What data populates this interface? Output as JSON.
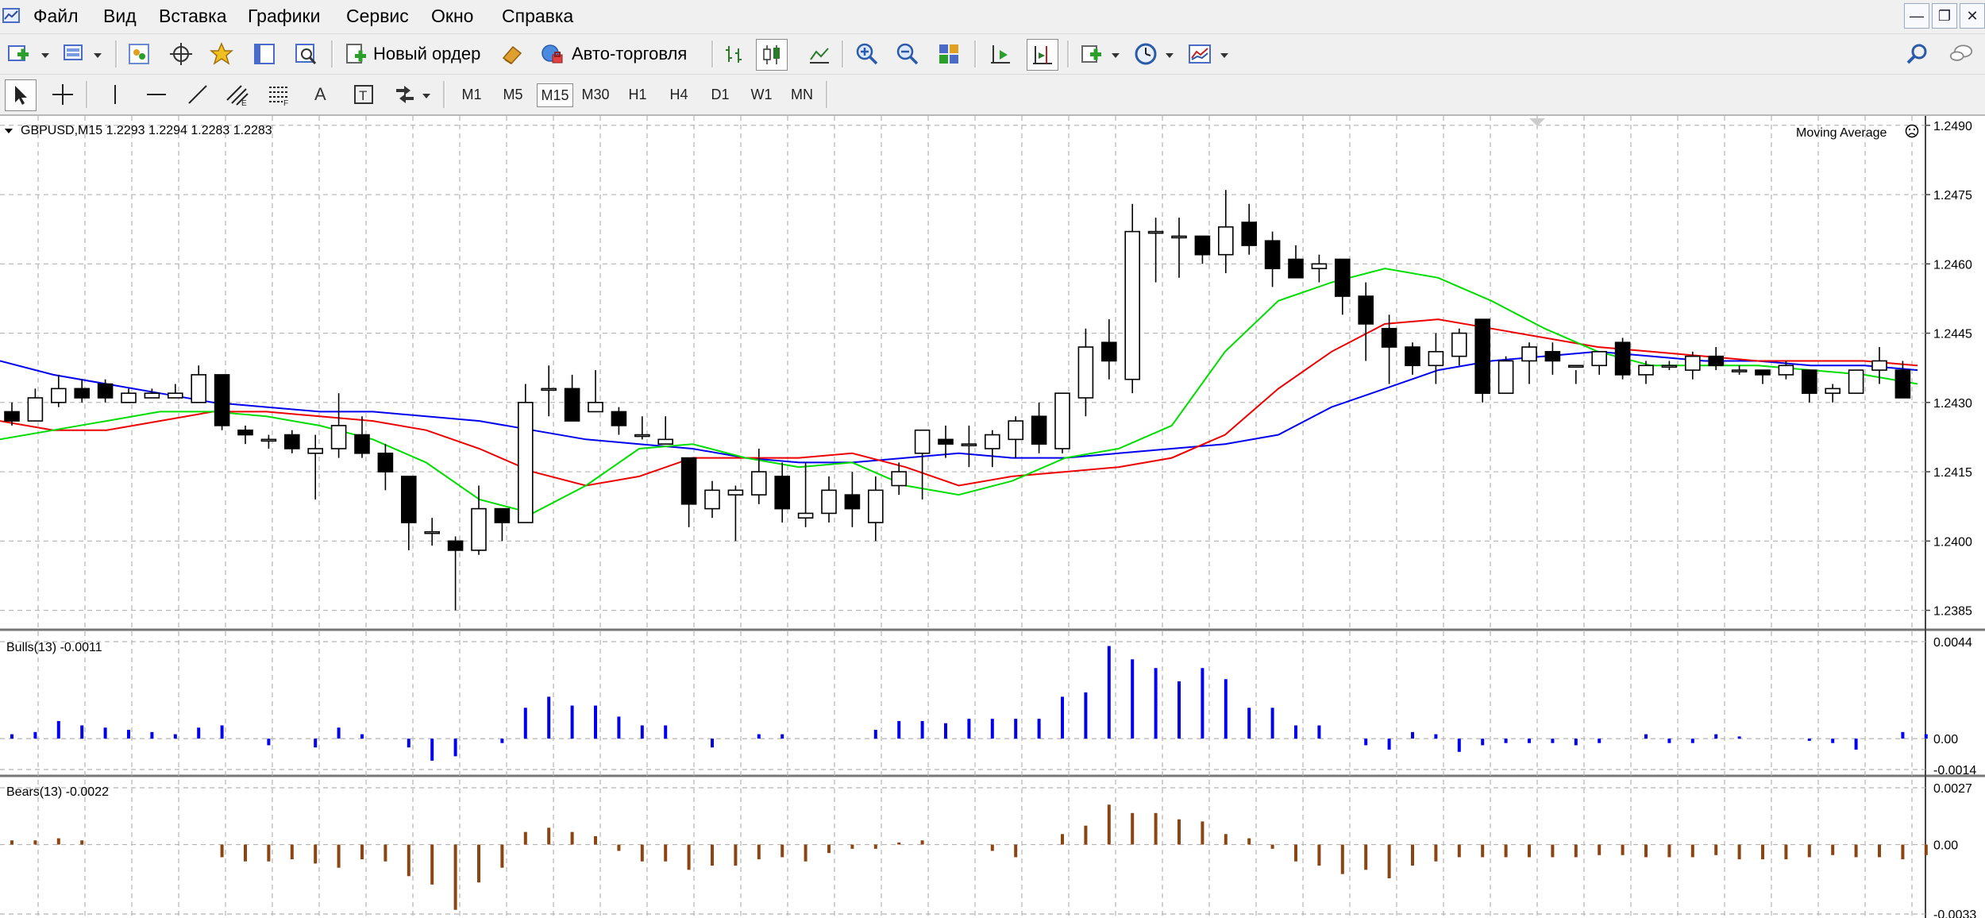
{
  "menu": {
    "items": [
      "Файл",
      "Вид",
      "Вставка",
      "Графики",
      "Сервис",
      "Окно",
      "Справка"
    ],
    "window_buttons": [
      "minimize-button",
      "restore-button",
      "close-button"
    ]
  },
  "toolbar": {
    "new_order_label": "Новый ордер",
    "auto_trading_label": "Авто-торговля",
    "timeframes": [
      "M1",
      "M5",
      "M15",
      "M30",
      "H1",
      "H4",
      "D1",
      "W1",
      "MN"
    ],
    "active_timeframe": "M15",
    "text_tool_label": "A"
  },
  "chart": {
    "header": "GBPUSD,M15  1.2293 1.2294 1.2283 1.2283",
    "symbol": "GBPUSD",
    "timeframe": "M15",
    "ohlc": [
      1.2293,
      1.2294,
      1.2283,
      1.2283
    ],
    "indicator_label": "Moving Average",
    "price_ticks": [
      "1.2490",
      "1.2475",
      "1.2460",
      "1.2445",
      "1.2430",
      "1.2415",
      "1.2400",
      "1.2385"
    ],
    "bulls_label": "Bulls(13) -0.0011",
    "bulls_ticks": [
      "0.0044",
      "0.00",
      "-0.0014"
    ],
    "bears_label": "Bears(13) -0.0022",
    "bears_ticks": [
      "0.0027",
      "0.00",
      "-0.0033"
    ],
    "colors": {
      "bulls": "#0000ee",
      "bears": "#8b4513",
      "ma_fast": "#00dd00",
      "ma_mid": "#ee0000",
      "ma_slow": "#0000ee",
      "grid": "#b4b4b4"
    }
  },
  "chart_data": [
    {
      "type": "candlestick",
      "title": "GBPUSD,M15",
      "ylim": [
        1.2382,
        1.2491
      ],
      "candles": [
        [
          1.2428,
          1.243,
          1.2425,
          1.2426
        ],
        [
          1.2426,
          1.2433,
          1.2426,
          1.2431
        ],
        [
          1.243,
          1.2436,
          1.2429,
          1.2433
        ],
        [
          1.2433,
          1.2435,
          1.243,
          1.2431
        ],
        [
          1.2434,
          1.2435,
          1.243,
          1.2431
        ],
        [
          1.243,
          1.2433,
          1.243,
          1.2432
        ],
        [
          1.2431,
          1.2433,
          1.2431,
          1.2432
        ],
        [
          1.2431,
          1.2434,
          1.2431,
          1.2432
        ],
        [
          1.243,
          1.2438,
          1.243,
          1.2436
        ],
        [
          1.2436,
          1.2436,
          1.2424,
          1.2425
        ],
        [
          1.2424,
          1.2425,
          1.2421,
          1.2423
        ],
        [
          1.2422,
          1.2423,
          1.242,
          1.2422
        ],
        [
          1.2423,
          1.2424,
          1.2419,
          1.242
        ],
        [
          1.2419,
          1.2423,
          1.2409,
          1.242
        ],
        [
          1.242,
          1.2432,
          1.2418,
          1.2425
        ],
        [
          1.2423,
          1.2427,
          1.2418,
          1.2419
        ],
        [
          1.2419,
          1.2421,
          1.2411,
          1.2415
        ],
        [
          1.2414,
          1.2414,
          1.2398,
          1.2404
        ],
        [
          1.2402,
          1.2405,
          1.2399,
          1.2402
        ],
        [
          1.24,
          1.2401,
          1.2385,
          1.2398
        ],
        [
          1.2398,
          1.2412,
          1.2397,
          1.2407
        ],
        [
          1.2407,
          1.2407,
          1.24,
          1.2404
        ],
        [
          1.2404,
          1.2434,
          1.2404,
          1.243
        ],
        [
          1.2433,
          1.2438,
          1.2427,
          1.2433
        ],
        [
          1.2433,
          1.2436,
          1.2426,
          1.2426
        ],
        [
          1.2428,
          1.2437,
          1.2428,
          1.243
        ],
        [
          1.2428,
          1.2429,
          1.2423,
          1.2425
        ],
        [
          1.2423,
          1.2427,
          1.2422,
          1.2423
        ],
        [
          1.2421,
          1.2427,
          1.2421,
          1.2422
        ],
        [
          1.2418,
          1.2418,
          1.2403,
          1.2408
        ],
        [
          1.2407,
          1.2413,
          1.2405,
          1.2411
        ],
        [
          1.241,
          1.2412,
          1.24,
          1.2411
        ],
        [
          1.241,
          1.242,
          1.2408,
          1.2415
        ],
        [
          1.2414,
          1.2417,
          1.2404,
          1.2407
        ],
        [
          1.2405,
          1.2417,
          1.2403,
          1.2406
        ],
        [
          1.2406,
          1.2414,
          1.2404,
          1.2411
        ],
        [
          1.241,
          1.2415,
          1.2403,
          1.2407
        ],
        [
          1.2404,
          1.2414,
          1.24,
          1.2411
        ],
        [
          1.2412,
          1.2417,
          1.241,
          1.2415
        ],
        [
          1.2419,
          1.2423,
          1.2409,
          1.2424
        ],
        [
          1.2422,
          1.2425,
          1.2418,
          1.2421
        ],
        [
          1.2421,
          1.2425,
          1.2416,
          1.2421
        ],
        [
          1.242,
          1.2424,
          1.2416,
          1.2423
        ],
        [
          1.2422,
          1.2427,
          1.2418,
          1.2426
        ],
        [
          1.2427,
          1.243,
          1.2419,
          1.2421
        ],
        [
          1.242,
          1.2431,
          1.2419,
          1.2432
        ],
        [
          1.2431,
          1.2446,
          1.2427,
          1.2442
        ],
        [
          1.2443,
          1.2448,
          1.2435,
          1.2439
        ],
        [
          1.2435,
          1.2473,
          1.2432,
          1.2467
        ],
        [
          1.2467,
          1.247,
          1.2456,
          1.2467
        ],
        [
          1.2466,
          1.247,
          1.2457,
          1.2466
        ],
        [
          1.2466,
          1.2466,
          1.246,
          1.2462
        ],
        [
          1.2462,
          1.2476,
          1.2458,
          1.2468
        ],
        [
          1.2469,
          1.2473,
          1.2462,
          1.2464
        ],
        [
          1.2465,
          1.2467,
          1.2455,
          1.2459
        ],
        [
          1.2461,
          1.2464,
          1.2457,
          1.2457
        ],
        [
          1.2459,
          1.2462,
          1.2456,
          1.246
        ],
        [
          1.2461,
          1.246,
          1.2449,
          1.2453
        ],
        [
          1.2453,
          1.2456,
          1.2439,
          1.2447
        ],
        [
          1.2446,
          1.2449,
          1.2434,
          1.2442
        ],
        [
          1.2442,
          1.2443,
          1.2436,
          1.2438
        ],
        [
          1.2438,
          1.2445,
          1.2434,
          1.2441
        ],
        [
          1.244,
          1.2446,
          1.2438,
          1.2445
        ],
        [
          1.2448,
          1.2448,
          1.243,
          1.2432
        ],
        [
          1.2432,
          1.244,
          1.2432,
          1.2439
        ],
        [
          1.2439,
          1.2443,
          1.2434,
          1.2442
        ],
        [
          1.2441,
          1.2443,
          1.2436,
          1.2439
        ],
        [
          1.2438,
          1.2437,
          1.2434,
          1.2438
        ],
        [
          1.2438,
          1.2441,
          1.2436,
          1.2441
        ],
        [
          1.2443,
          1.2444,
          1.2435,
          1.2436
        ],
        [
          1.2436,
          1.2439,
          1.2434,
          1.2438
        ],
        [
          1.2438,
          1.2439,
          1.2437,
          1.2438
        ],
        [
          1.2437,
          1.2441,
          1.2435,
          1.244
        ],
        [
          1.244,
          1.2442,
          1.2437,
          1.2438
        ],
        [
          1.2437,
          1.2438,
          1.2436,
          1.2437
        ],
        [
          1.2437,
          1.2437,
          1.2434,
          1.2436
        ],
        [
          1.2436,
          1.2439,
          1.2435,
          1.2438
        ],
        [
          1.2437,
          1.2436,
          1.243,
          1.2432
        ],
        [
          1.2432,
          1.2434,
          1.243,
          1.2433
        ],
        [
          1.2432,
          1.2437,
          1.2432,
          1.2437
        ],
        [
          1.2437,
          1.2442,
          1.2434,
          1.2439
        ],
        [
          1.2437,
          1.2439,
          1.2432,
          1.2431
        ]
      ],
      "moving_averages": [
        {
          "color": "#0000ee",
          "values": [
            1.2439,
            1.2436,
            1.2434,
            1.2432,
            1.243,
            1.2429,
            1.2428,
            1.2428,
            1.2427,
            1.2426,
            1.2424,
            1.2422,
            1.2421,
            1.242,
            1.2418,
            1.2417,
            1.2417,
            1.2418,
            1.2419,
            1.2418,
            1.2418,
            1.2419,
            1.242,
            1.2421,
            1.2423,
            1.2429,
            1.2433,
            1.2437,
            1.2439,
            1.244,
            1.2441,
            1.244,
            1.2439,
            1.2439,
            1.2438,
            1.2438,
            1.2437
          ]
        },
        {
          "color": "#ee0000",
          "values": [
            1.2426,
            1.2424,
            1.2424,
            1.2426,
            1.2428,
            1.2428,
            1.2427,
            1.2426,
            1.2424,
            1.242,
            1.2415,
            1.2412,
            1.2414,
            1.2418,
            1.2418,
            1.2418,
            1.2419,
            1.2416,
            1.2412,
            1.2414,
            1.2415,
            1.2416,
            1.2418,
            1.2423,
            1.2433,
            1.2441,
            1.2447,
            1.2448,
            1.2446,
            1.2444,
            1.2442,
            1.2441,
            1.244,
            1.2439,
            1.2439,
            1.2439,
            1.2438
          ]
        },
        {
          "color": "#00dd00",
          "values": [
            1.2422,
            1.2424,
            1.2426,
            1.2428,
            1.2428,
            1.2427,
            1.2425,
            1.2422,
            1.2417,
            1.2409,
            1.2406,
            1.2412,
            1.242,
            1.2421,
            1.2418,
            1.2416,
            1.2417,
            1.2412,
            1.241,
            1.2413,
            1.2418,
            1.242,
            1.2425,
            1.2441,
            1.2452,
            1.2456,
            1.2459,
            1.2457,
            1.2452,
            1.2446,
            1.2441,
            1.2438,
            1.2438,
            1.2438,
            1.2437,
            1.2436,
            1.2434
          ]
        }
      ]
    },
    {
      "type": "bar",
      "title": "Bulls(13)",
      "ylim": [
        -0.0014,
        0.0044
      ],
      "values": [
        0.0002,
        0.0003,
        0.0008,
        0.0006,
        0.0005,
        0.0004,
        0.0003,
        0.0002,
        0.0005,
        0.0006,
        0.0,
        -0.0003,
        0.0,
        -0.0004,
        0.0005,
        0.0002,
        0.0,
        -0.0004,
        -0.001,
        -0.0008,
        0.0,
        -0.0002,
        0.0014,
        0.0019,
        0.0015,
        0.0015,
        0.001,
        0.0006,
        0.0006,
        0.0,
        -0.0004,
        0.0,
        0.0002,
        0.0002,
        0.0,
        0.0,
        0.0,
        0.0004,
        0.0008,
        0.0008,
        0.0007,
        0.0009,
        0.0009,
        0.0009,
        0.0009,
        0.0019,
        0.0021,
        0.0042,
        0.0036,
        0.0032,
        0.0026,
        0.0032,
        0.0027,
        0.0014,
        0.0014,
        0.0006,
        0.0006,
        0.0,
        -0.0003,
        -0.0005,
        0.0003,
        0.0002,
        -0.0006,
        -0.0003,
        -0.0002,
        -0.0002,
        -0.0002,
        -0.0003,
        -0.0002,
        0.0,
        0.0002,
        -0.0002,
        -0.0002,
        0.0002,
        0.0001,
        0.0,
        0.0,
        -0.0001,
        -0.0002,
        -0.0005,
        0.0,
        0.0003,
        0.0002
      ]
    },
    {
      "type": "bar",
      "title": "Bears(13)",
      "ylim": [
        -0.0033,
        0.0027
      ],
      "values": [
        0.0002,
        0.0002,
        0.0003,
        0.0002,
        0.0,
        0.0,
        0.0,
        0.0,
        0.0,
        -0.0006,
        -0.0008,
        -0.0008,
        -0.0007,
        -0.0009,
        -0.0011,
        -0.0007,
        -0.0008,
        -0.0015,
        -0.0019,
        -0.0031,
        -0.0018,
        -0.0011,
        0.0006,
        0.0008,
        0.0006,
        0.0004,
        -0.0003,
        -0.0008,
        -0.0008,
        -0.0012,
        -0.001,
        -0.001,
        -0.0007,
        -0.0006,
        -0.0008,
        -0.0004,
        -0.0002,
        -0.0002,
        0.0001,
        0.0002,
        0.0,
        0.0,
        -0.0003,
        -0.0006,
        0.0,
        0.0005,
        0.0009,
        0.0019,
        0.0015,
        0.0015,
        0.0012,
        0.0011,
        0.0005,
        0.0003,
        -0.0002,
        -0.0008,
        -0.001,
        -0.0014,
        -0.0012,
        -0.0016,
        -0.001,
        -0.0008,
        -0.0006,
        -0.0006,
        -0.0006,
        -0.0006,
        -0.0006,
        -0.0006,
        -0.0005,
        -0.0005,
        -0.0006,
        -0.0006,
        -0.0006,
        -0.0005,
        -0.0007,
        -0.0007,
        -0.0007,
        -0.0006,
        -0.0005,
        -0.0006,
        -0.0006,
        -0.0007,
        -0.0005
      ]
    }
  ]
}
